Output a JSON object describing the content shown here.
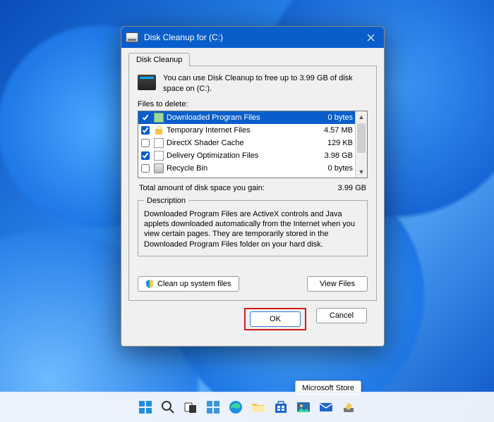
{
  "window": {
    "title": "Disk Cleanup for  (C:)"
  },
  "tab_label": "Disk Cleanup",
  "intro": "You can use Disk Cleanup to free up to 3.99 GB of disk space on  (C:).",
  "files_label": "Files to delete:",
  "files": [
    {
      "checked": true,
      "name": "Downloaded Program Files",
      "size": "0 bytes",
      "icon": "green",
      "selected": true
    },
    {
      "checked": true,
      "name": "Temporary Internet Files",
      "size": "4.57 MB",
      "icon": "lock",
      "selected": false
    },
    {
      "checked": false,
      "name": "DirectX Shader Cache",
      "size": "129 KB",
      "icon": "file",
      "selected": false
    },
    {
      "checked": true,
      "name": "Delivery Optimization Files",
      "size": "3.98 GB",
      "icon": "file",
      "selected": false
    },
    {
      "checked": false,
      "name": "Recycle Bin",
      "size": "0 bytes",
      "icon": "bin",
      "selected": false
    }
  ],
  "total_label": "Total amount of disk space you gain:",
  "total_value": "3.99 GB",
  "desc_legend": "Description",
  "desc_text": "Downloaded Program Files are ActiveX controls and Java applets downloaded automatically from the Internet when you view certain pages. They are temporarily stored in the Downloaded Program Files folder on your hard disk.",
  "buttons": {
    "cleanup_system": "Clean up system files",
    "view_files": "View Files",
    "ok": "OK",
    "cancel": "Cancel"
  },
  "tooltip": "Microsoft Store",
  "taskbar": [
    "start",
    "search",
    "taskview",
    "widgets",
    "edge",
    "explorer",
    "store",
    "photos",
    "mail",
    "cleanup"
  ]
}
